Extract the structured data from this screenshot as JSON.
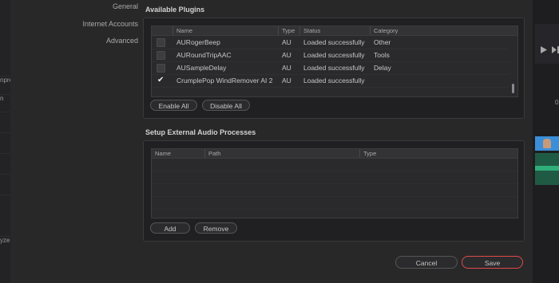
{
  "left_strip": [
    "npre",
    "n",
    "yzer"
  ],
  "nav": [
    "General",
    "Internet Accounts",
    "Advanced"
  ],
  "plugins": {
    "title": "Available Plugins",
    "columns": [
      "Name",
      "Type",
      "Status",
      "Category"
    ],
    "rows": [
      {
        "checked": false,
        "name": "AURogerBeep",
        "type": "AU",
        "status": "Loaded successfully",
        "category": "Other"
      },
      {
        "checked": false,
        "name": "AURoundTripAAC",
        "type": "AU",
        "status": "Loaded successfully",
        "category": "Tools"
      },
      {
        "checked": false,
        "name": "AUSampleDelay",
        "type": "AU",
        "status": "Loaded successfully",
        "category": "Delay"
      },
      {
        "checked": true,
        "name": "CrumplePop WindRemover AI 2",
        "type": "AU",
        "status": "Loaded successfully",
        "category": ""
      }
    ],
    "enable_all": "Enable All",
    "disable_all": "Disable All"
  },
  "external": {
    "title": "Setup External Audio Processes",
    "columns": [
      "Name",
      "Path",
      "Type"
    ],
    "add": "Add",
    "remove": "Remove"
  },
  "footer": {
    "cancel": "Cancel",
    "save": "Save"
  },
  "colors": {
    "save_border": "#e04a4a",
    "timeline_blue": "#3b8fd8",
    "audio_green": "#2fae7a"
  },
  "icons": [
    "play-icon",
    "next-icon"
  ]
}
